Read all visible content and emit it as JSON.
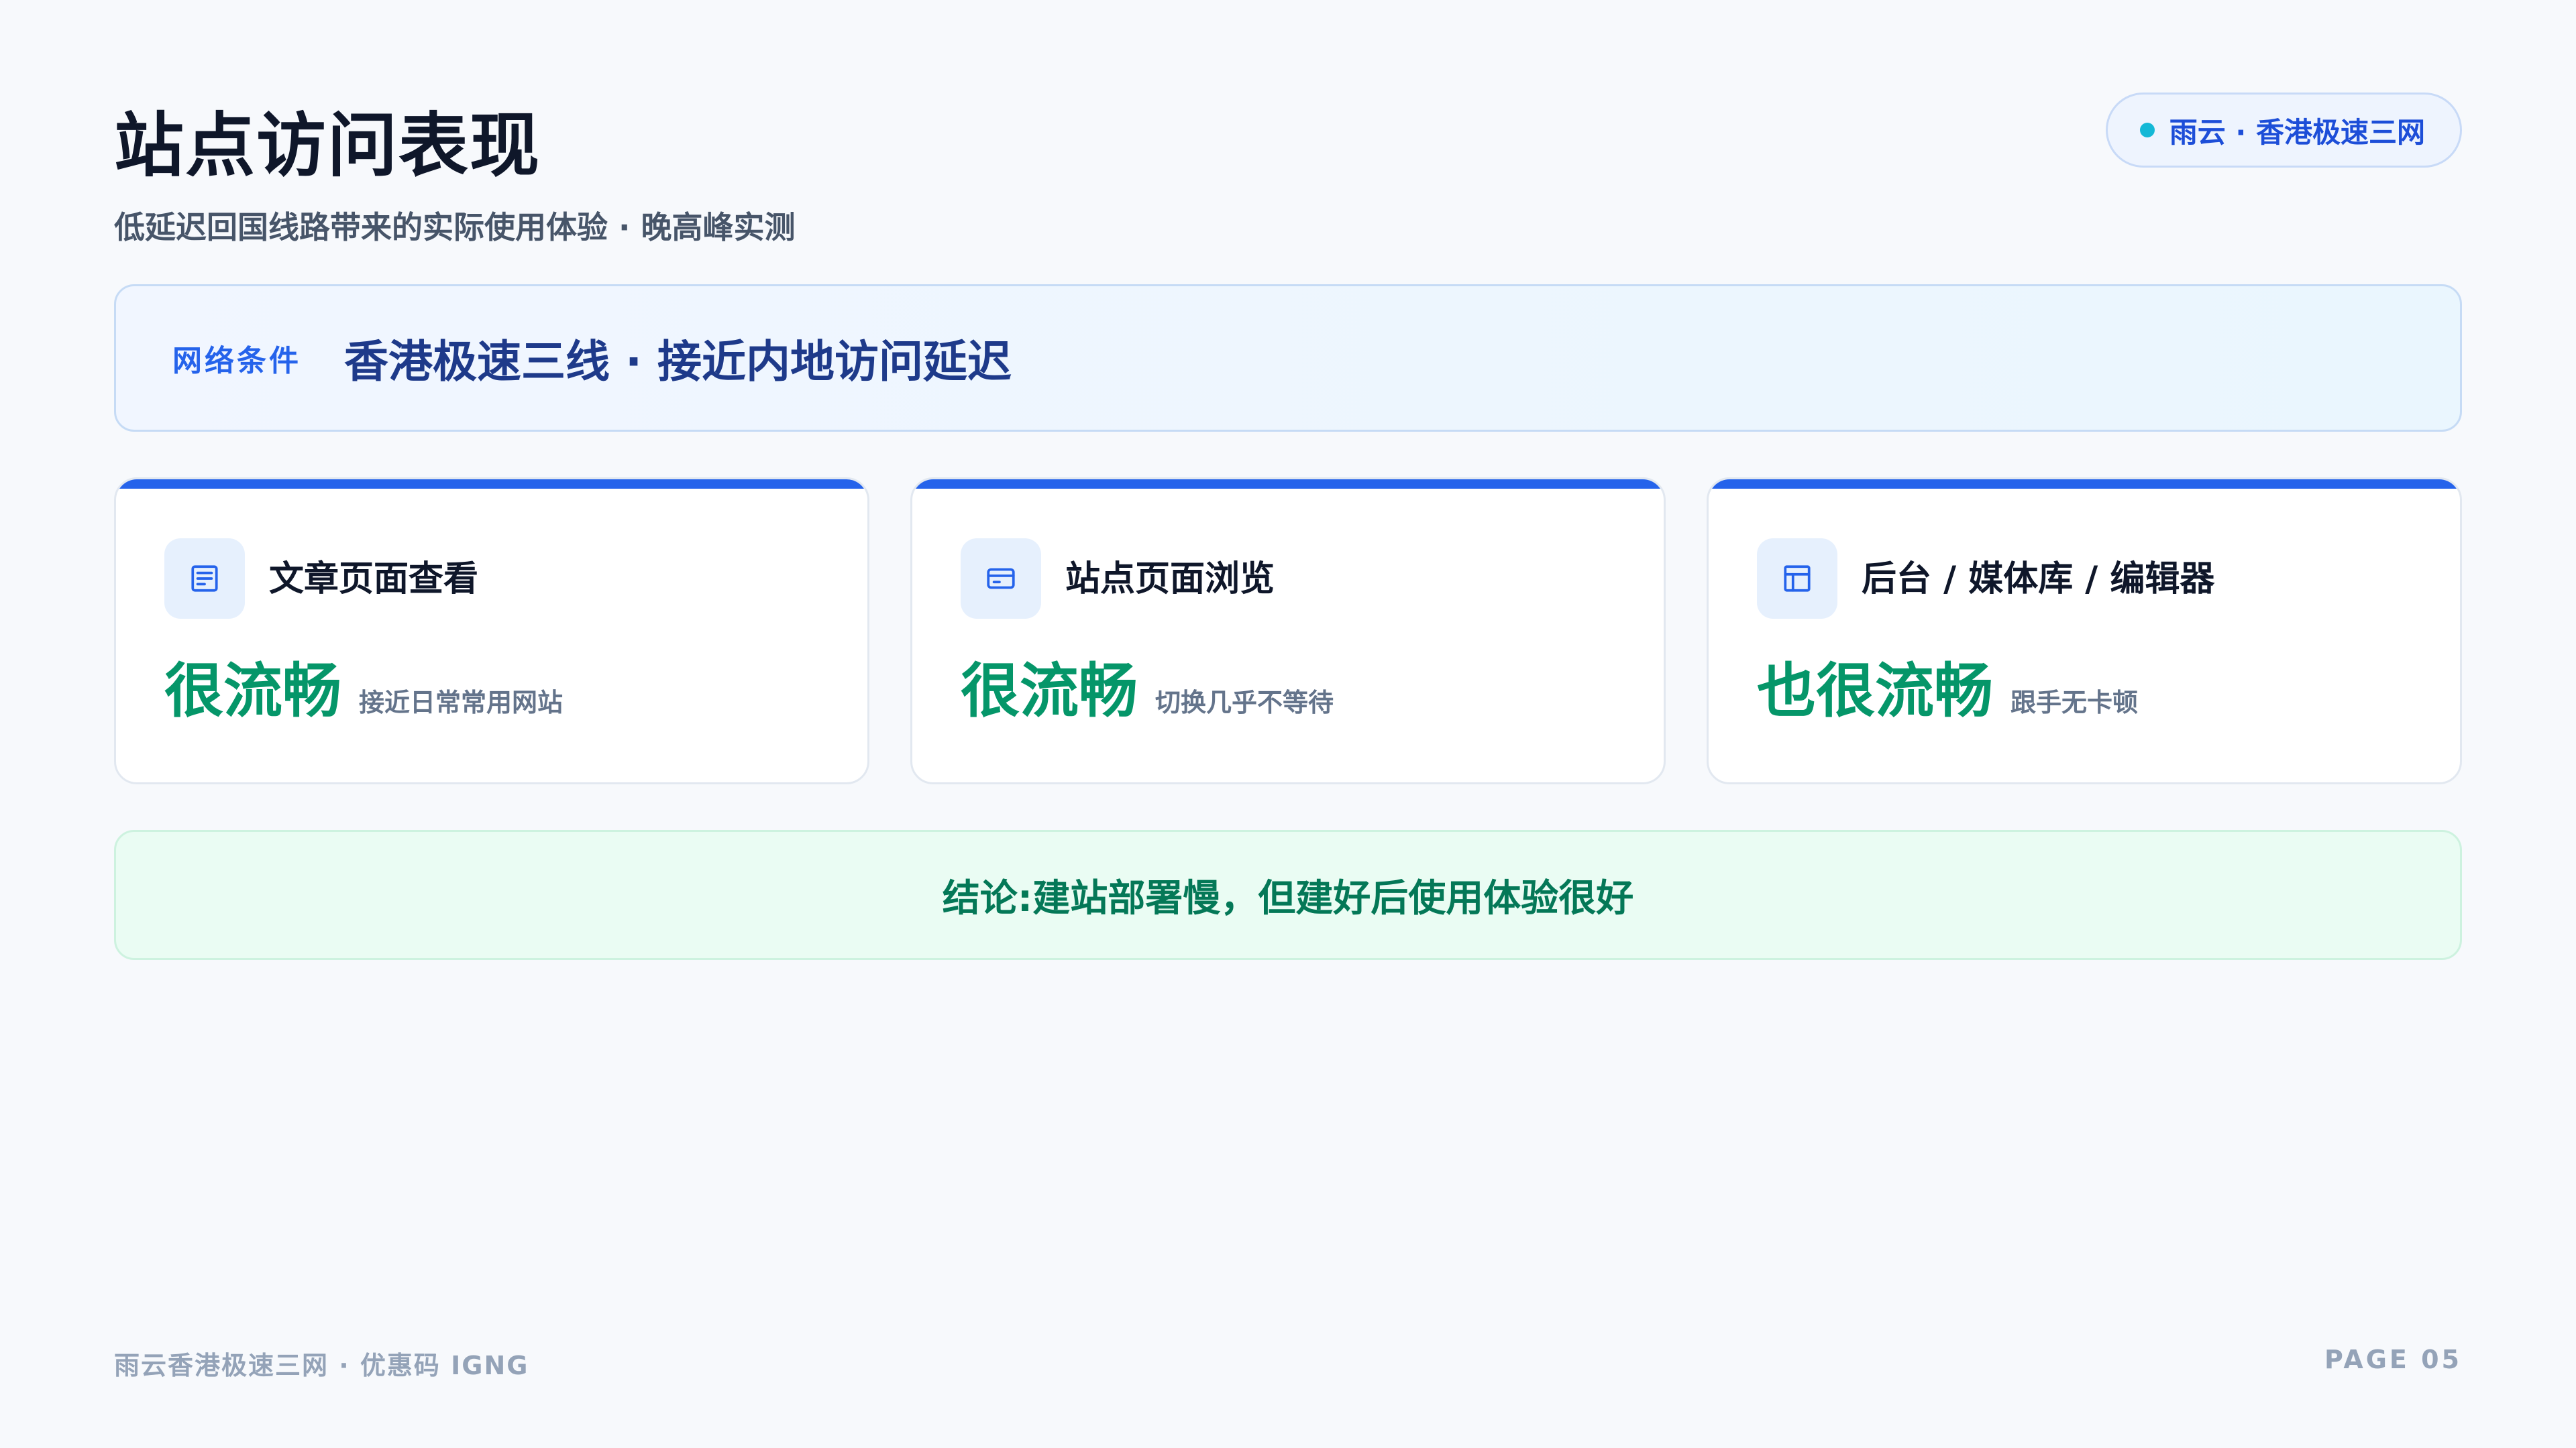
{
  "header": {
    "title": "站点访问表现",
    "subtitle": "低延迟回国线路带来的实际使用体验 · 晚高峰实测",
    "brand": "雨云 · 香港极速三网"
  },
  "network": {
    "label": "网络条件",
    "value": "香港极速三线 · 接近内地访问延迟"
  },
  "cards": [
    {
      "icon": "article-icon",
      "title": "文章页面查看",
      "big": "很流畅",
      "note": "接近日常常用网站"
    },
    {
      "icon": "browser-card-icon",
      "title": "站点页面浏览",
      "big": "很流畅",
      "note": "切换几乎不等待"
    },
    {
      "icon": "layout-panel-icon",
      "title": "后台 / 媒体库 / 编辑器",
      "big": "也很流畅",
      "note": "跟手无卡顿"
    }
  ],
  "conclusion": "结论:建站部署慢，但建好后使用体验很好",
  "footer": {
    "left": "雨云香港极速三网 · 优惠码 IGNG",
    "right": "PAGE 05"
  },
  "colors": {
    "accent": "#2563eb",
    "success": "#059669",
    "title": "#0f172a",
    "muted": "#94a3b8",
    "background": "#f7f9fc"
  }
}
